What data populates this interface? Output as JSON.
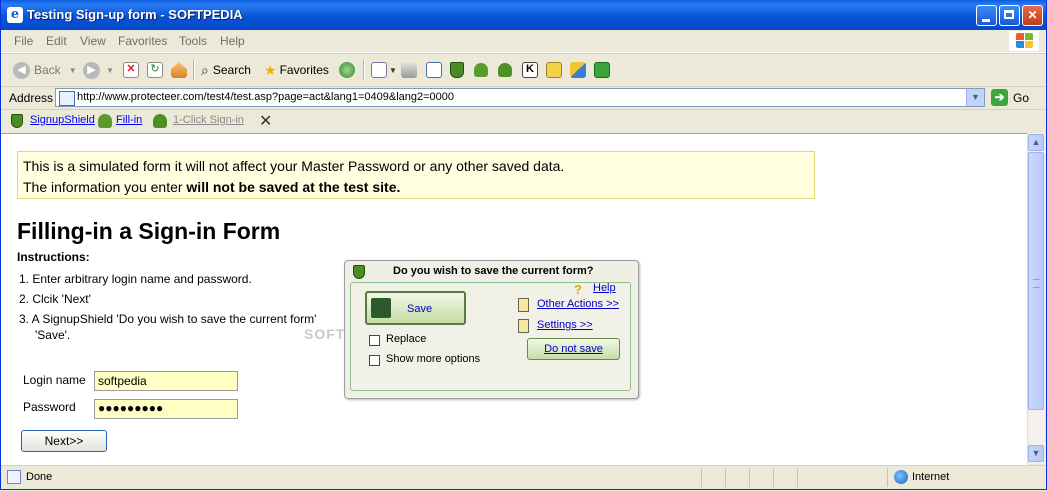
{
  "window": {
    "title": "Testing Sign-up form - SOFTPEDIA"
  },
  "menu": [
    "File",
    "Edit",
    "View",
    "Favorites",
    "Tools",
    "Help"
  ],
  "toolbar": {
    "back_label": "Back",
    "search_label": "Search",
    "favorites_label": "Favorites"
  },
  "address": {
    "label": "Address",
    "url": "http://www.protecteer.com/test4/test.asp?page=act&lang1=0409&lang2=0000",
    "go_label": "Go"
  },
  "links": {
    "signupshield": "SignupShield",
    "fill_in": "Fill-in",
    "one_click": "1-Click Sign-in"
  },
  "page": {
    "notice_line1": "This is a simulated form it will not affect your Master Password or any other saved data.",
    "notice_line2_prefix": "The information you enter ",
    "notice_line2_bold": "will not be saved at the test site.",
    "heading": "Filling-in a Sign-in Form",
    "instructions_label": "Instructions:",
    "steps": [
      "1. Enter arbitrary login name and password.",
      "2. Clcik 'Next'",
      "3. A SignupShield 'Do you wish to save the current form'",
      "'Save'."
    ],
    "login_label": "Login name",
    "login_value": "softpedia",
    "password_label": "Password",
    "password_value": "●●●●●●●●●",
    "next_button": "Next>>"
  },
  "popup": {
    "title": "Do you wish to save the current form?",
    "save_button": "Save",
    "replace_label": "Replace",
    "show_more_label": "Show more options",
    "help_link": "Help",
    "other_actions_link": "Other Actions >>",
    "settings_link": "Settings >>",
    "do_not_save_button": "Do not save"
  },
  "status": {
    "text": "Done",
    "zone": "Internet"
  }
}
